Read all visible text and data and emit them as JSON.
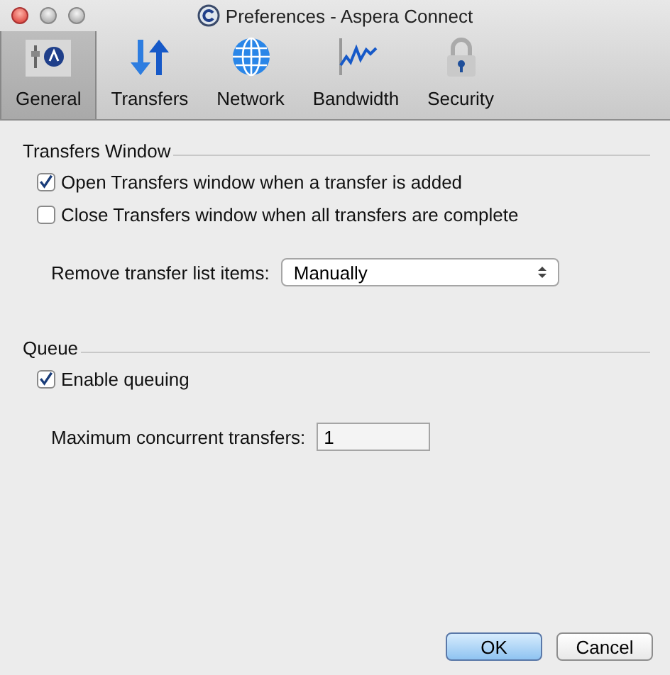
{
  "window": {
    "title": "Preferences - Aspera Connect"
  },
  "tabs": [
    {
      "label": "General",
      "selected": true
    },
    {
      "label": "Transfers",
      "selected": false
    },
    {
      "label": "Network",
      "selected": false
    },
    {
      "label": "Bandwidth",
      "selected": false
    },
    {
      "label": "Security",
      "selected": false
    }
  ],
  "sections": [
    {
      "title": "Transfers Window",
      "items": [
        {
          "kind": "checkbox",
          "label": "Open Transfers window when a transfer is added",
          "checked": true
        },
        {
          "kind": "checkbox",
          "label": "Close Transfers window when all transfers are complete",
          "checked": false
        },
        {
          "kind": "select",
          "label": "Remove transfer list items:",
          "value": "Manually"
        }
      ]
    },
    {
      "title": "Queue",
      "items": [
        {
          "kind": "checkbox",
          "label": "Enable queuing",
          "checked": true
        },
        {
          "kind": "field",
          "label": "Maximum concurrent transfers:",
          "value": "1"
        }
      ]
    }
  ],
  "buttons": [
    {
      "label": "OK",
      "default": true
    },
    {
      "label": "Cancel",
      "default": false
    }
  ]
}
